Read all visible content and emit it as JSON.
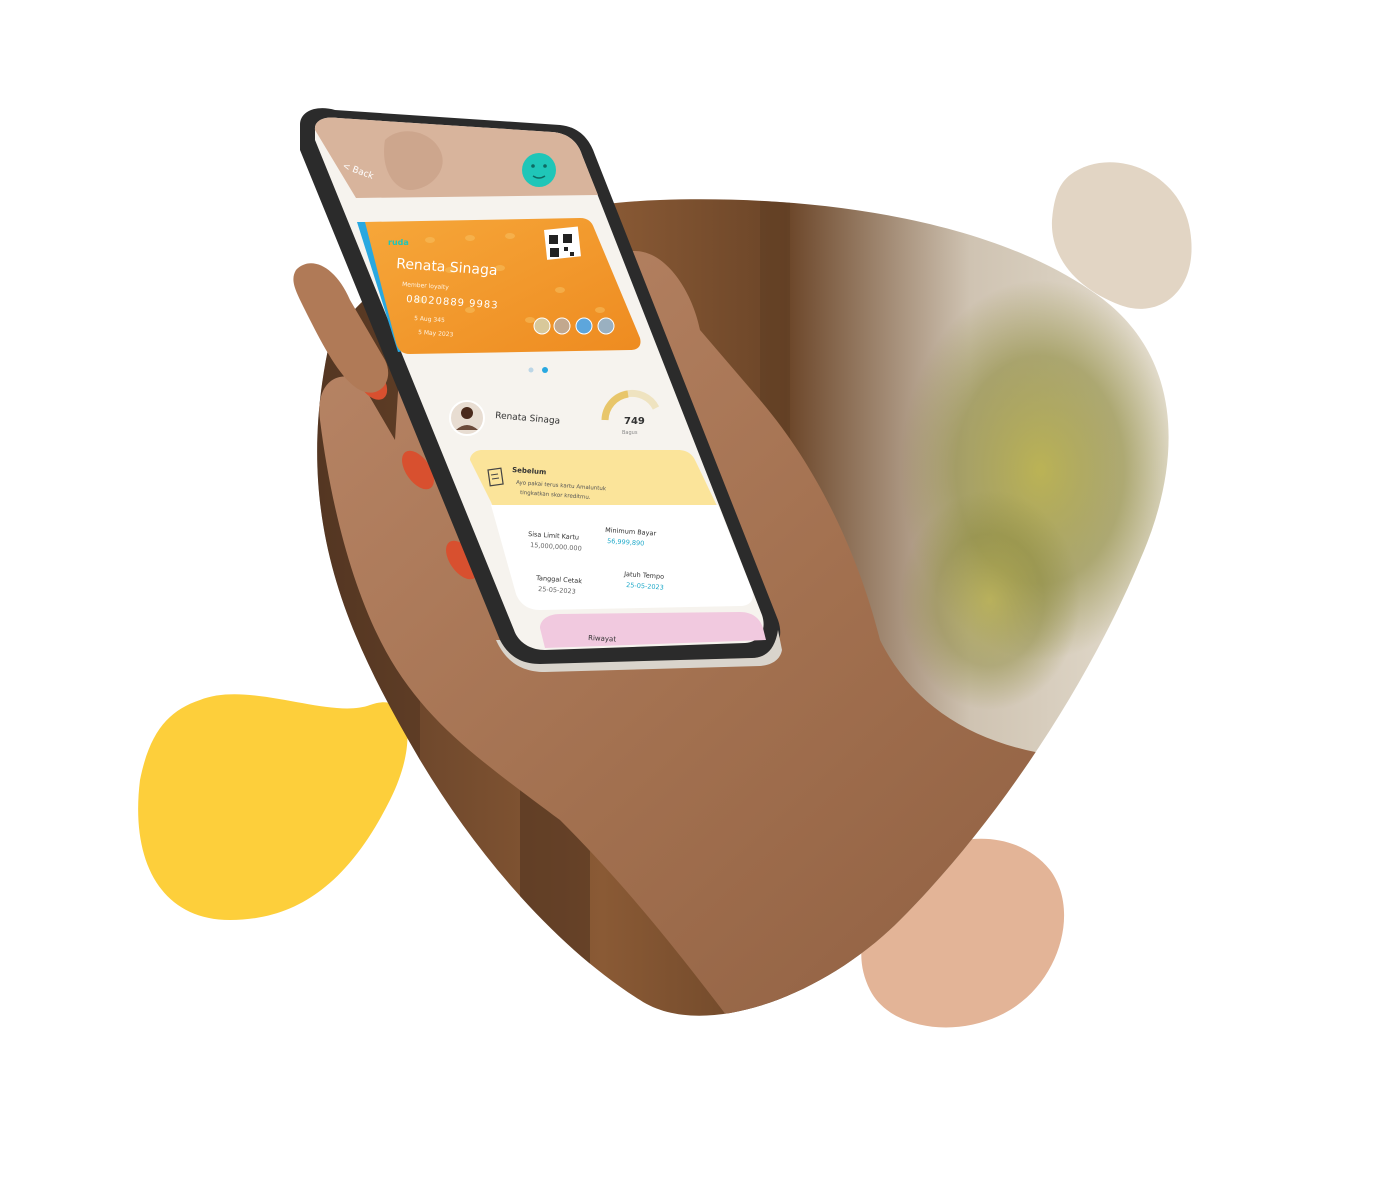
{
  "colors": {
    "background": "#ffffff",
    "blob_yellow": "#fdcf3b",
    "blob_beige": "#e2d5c4",
    "blob_peach": "#e3b497",
    "card_orange": "#f39a2c",
    "status_yellow": "#fbe49a",
    "teal_avatar": "#1fc6b8",
    "bottom_pink": "#f1c9df"
  },
  "icons": {
    "back": "chevron-left-icon",
    "profile": "face-icon",
    "qr": "qr-code-icon",
    "document": "document-icon"
  },
  "phone": {
    "back_label": "< Back",
    "card": {
      "brand": "ruda",
      "holder_name": "Renata Sinaga",
      "subtitle": "Member loyalty",
      "card_number": "08020889 9983",
      "line_1": "5 Aug 345",
      "line_2": "5 May 2023"
    },
    "profile": {
      "name": "Renata Sinaga",
      "score": "749",
      "score_caption": "Bagus"
    },
    "notice": {
      "title": "Sebelum",
      "text_1": "Ayo pakai terus kartu Amaluntuk",
      "text_2": "tingkatkan skor kreditmu."
    },
    "details": [
      {
        "label": "Sisa Limit Kartu",
        "value": "15,000,000.000",
        "accent": false
      },
      {
        "label": "Minimum Bayar",
        "value": "56,999,890",
        "accent": true
      },
      {
        "label": "Tanggal Cetak",
        "value": "25-05-2023",
        "accent": false
      },
      {
        "label": "Jatuh Tempo",
        "value": "25-05-2023",
        "accent": true
      }
    ],
    "bottom_button": "Riwayat"
  }
}
